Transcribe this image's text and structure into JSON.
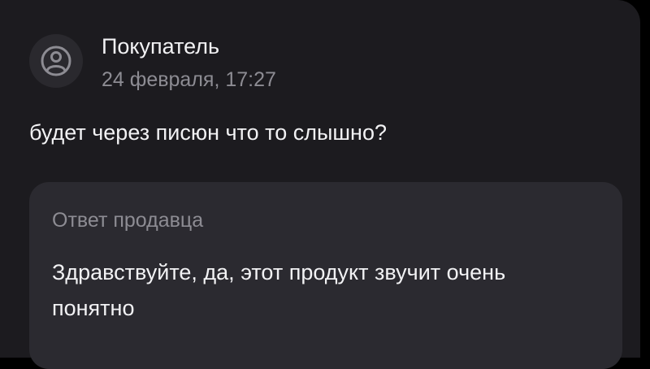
{
  "review": {
    "author": "Покупатель",
    "date": "24 февраля, 17:27",
    "avatar_icon": "user-circle-icon",
    "question": "будет через писюн что то слышно?"
  },
  "seller_reply": {
    "title": "Ответ продавца",
    "text": "Здравствуйте, да, этот продукт звучит очень понятно"
  },
  "colors": {
    "background": "#000000",
    "card": "#1c1b1f",
    "reply_box": "#2b2a30",
    "primary_text": "#f2f2f4",
    "secondary_text": "#8d8c93"
  }
}
